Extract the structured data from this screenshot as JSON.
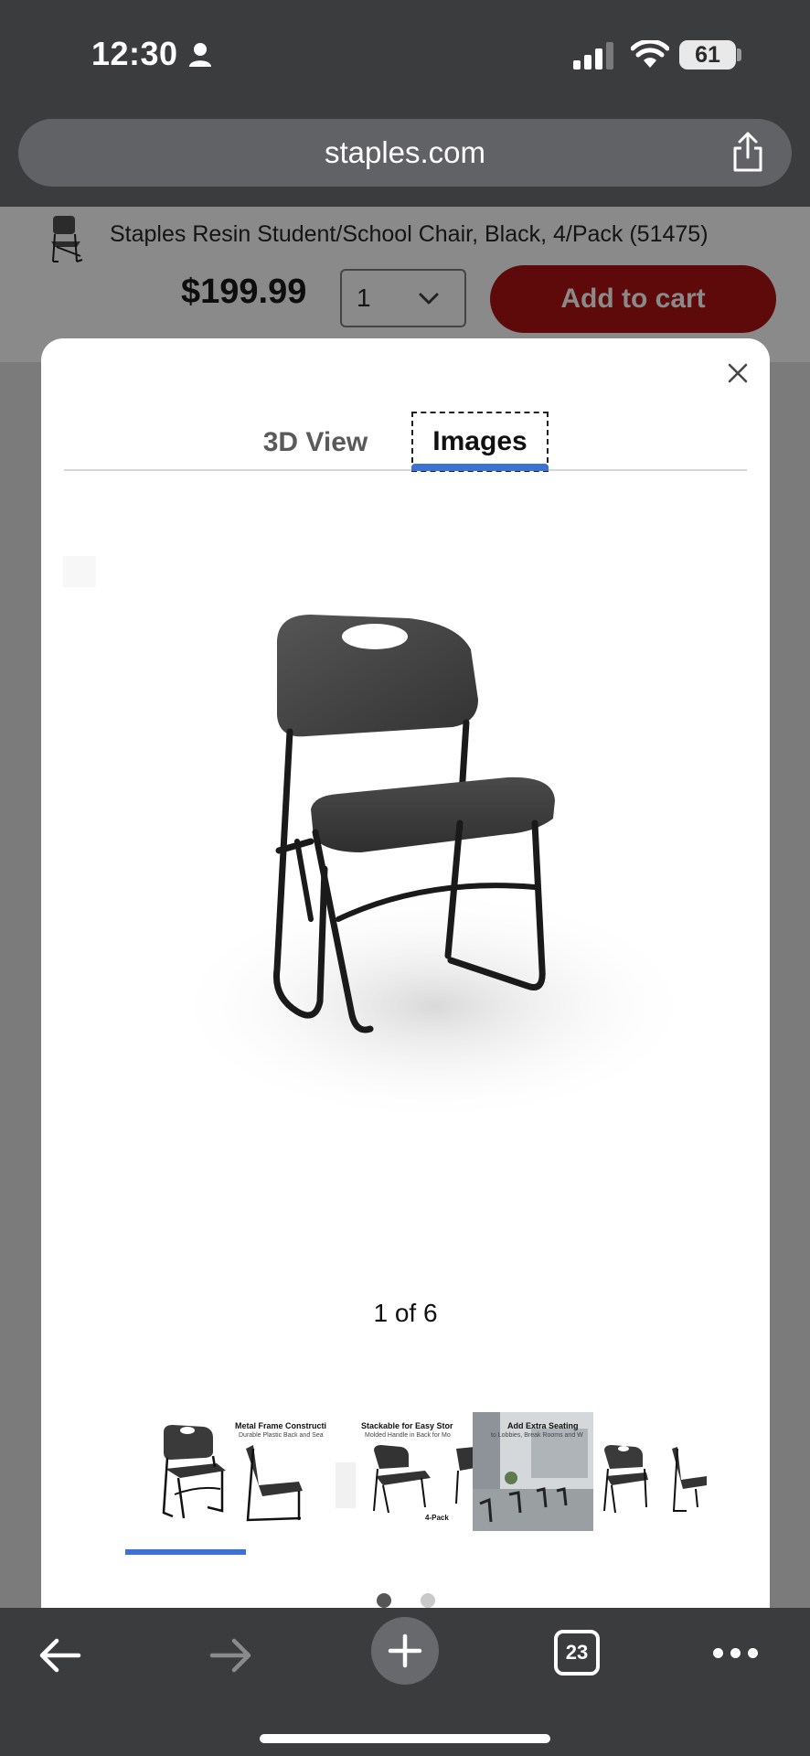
{
  "status_bar": {
    "time": "12:30",
    "battery": "61"
  },
  "browser": {
    "url": "staples.com"
  },
  "product": {
    "title": "Staples Resin Student/School Chair, Black, 4/Pack (51475)",
    "price": "$199.99",
    "quantity": "1",
    "add_to_cart_label": "Add to cart"
  },
  "modal": {
    "tabs": [
      {
        "label": "3D View",
        "active": false
      },
      {
        "label": "Images",
        "active": true
      }
    ],
    "counter": "1 of 6",
    "thumbnails": [
      {
        "caption": "",
        "sub": "",
        "selected": true
      },
      {
        "caption": "Metal Frame Constructi",
        "sub": "Durable Plastic Back and Sea",
        "selected": false
      },
      {
        "caption": "Stackable for Easy Stor",
        "sub": "Molded Handle in Back for Mo",
        "extra": "4-Pack",
        "selected": false
      },
      {
        "caption": "Add Extra Seating",
        "sub": "to Lobbies, Break Rooms and W",
        "selected": false
      },
      {
        "caption": "",
        "sub": "",
        "selected": false
      }
    ],
    "pagination_dots": 2,
    "active_dot": 0
  },
  "toolbar": {
    "tab_count": "23"
  },
  "colors": {
    "accent_blue": "#3a73d4",
    "cart_button": "#5e0a0a",
    "chrome_dark": "#3b3c3e"
  }
}
